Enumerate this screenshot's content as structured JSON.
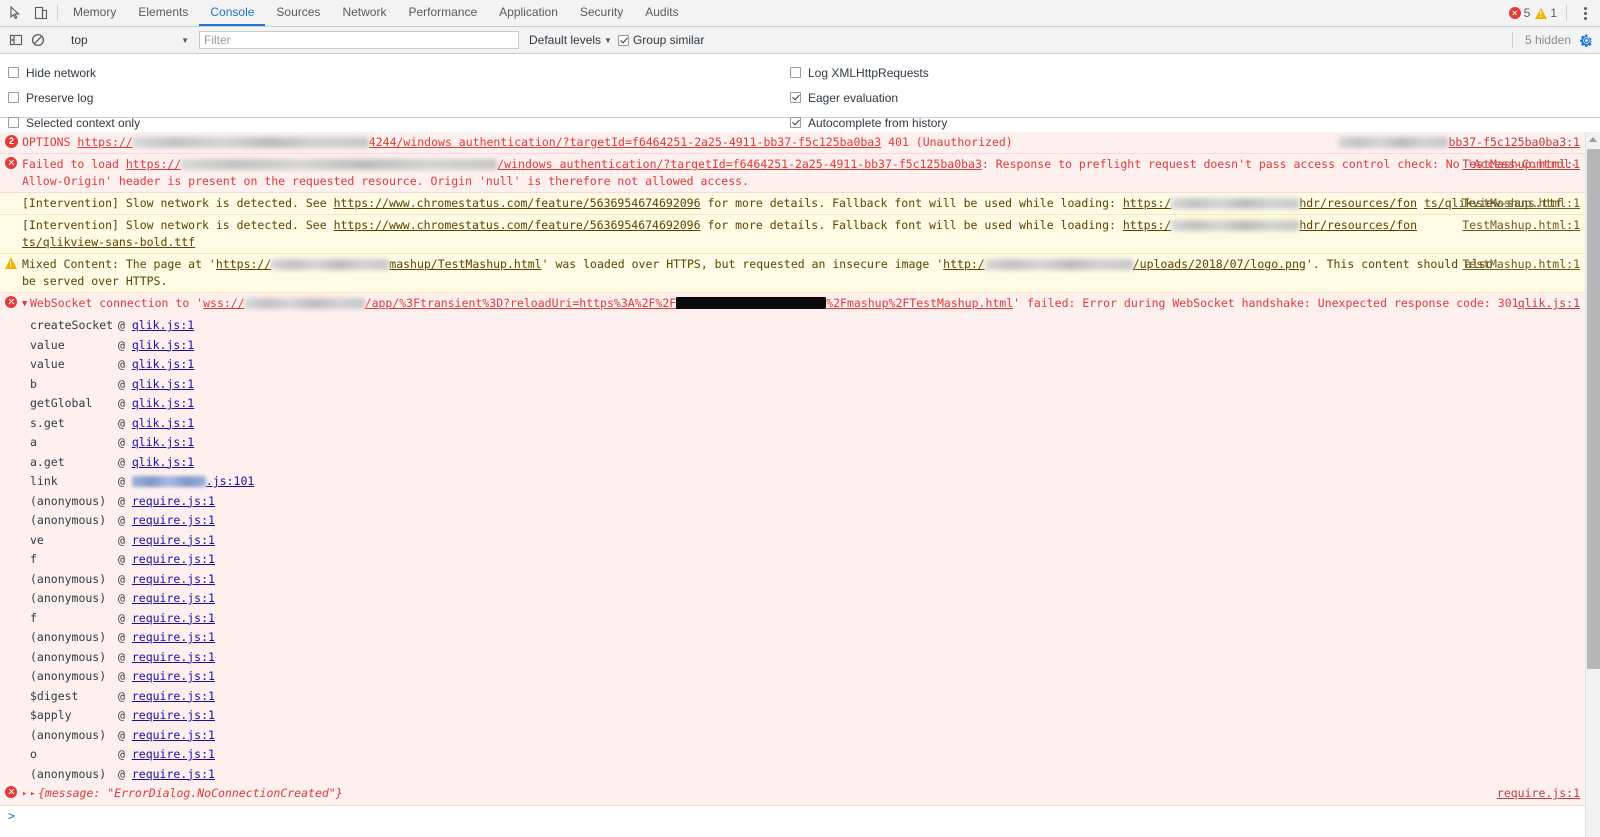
{
  "devtools": {
    "left_icons": [
      {
        "name": "inspect-element-icon",
        "glyph": "inspect"
      },
      {
        "name": "device-toolbar-icon",
        "glyph": "device"
      }
    ],
    "tabs": [
      {
        "label": "Memory",
        "active": false
      },
      {
        "label": "Elements",
        "active": false
      },
      {
        "label": "Console",
        "active": true
      },
      {
        "label": "Sources",
        "active": false
      },
      {
        "label": "Network",
        "active": false
      },
      {
        "label": "Performance",
        "active": false
      },
      {
        "label": "Application",
        "active": false
      },
      {
        "label": "Security",
        "active": false
      },
      {
        "label": "Audits",
        "active": false
      }
    ],
    "error_count": "5",
    "warning_count": "1",
    "more_menu": "kebab-menu-icon",
    "accent_color": "#1976d2",
    "error_color": "#e53935",
    "warning_color": "#f4b400"
  },
  "toolbar": {
    "sidebar_toggle": "console-sidebar-icon",
    "clear_console": "clear-console-icon",
    "context_value": "top",
    "filter_placeholder": "Filter",
    "filter_value": "",
    "levels_label": "Default levels",
    "group_similar_label": "Group similar",
    "group_similar_checked": true,
    "hidden_label": "5 hidden",
    "settings_icon": "gear-icon"
  },
  "settings": {
    "left": [
      {
        "label": "Hide network",
        "checked": false
      },
      {
        "label": "Preserve log",
        "checked": false
      },
      {
        "label": "Selected context only",
        "checked": false
      }
    ],
    "right": [
      {
        "label": "Log XMLHttpRequests",
        "checked": false
      },
      {
        "label": "Eager evaluation",
        "checked": true
      },
      {
        "label": "Autocomplete from history",
        "checked": true
      }
    ]
  },
  "console": {
    "messages": [
      {
        "level": "error",
        "badge": "2",
        "method": "OPTIONS",
        "url_prefix": "https://",
        "url_mid": "4244/windows authentication/?targetId=f6464251-2a25-4911-bb37-f5c125ba0ba3",
        "status": "401 (Unauthorized)",
        "source": "bb37-f5c125ba0ba3:1"
      },
      {
        "level": "error",
        "line1_a": "Failed to load ",
        "line1_url_prefix": "https://",
        "line1_url_suffix": "/windows authentication/?targetId=f6464251-2a25-4911-bb37-f5c125ba0ba3",
        "line1_b": ": Response to preflight request doesn't pass access control check: No 'Access-Control-",
        "line2": "Allow-Origin' header is present on the requested resource. Origin 'null' is therefore not allowed access.",
        "source": "TestMashup.html:1"
      },
      {
        "level": "warn",
        "line1_a": "[Intervention] Slow network is detected. See ",
        "link": "https://www.chromestatus.com/feature/5636954674692096",
        "line1_b": " for more details. Fallback font will be used while loading: ",
        "url_prefix": "https:/",
        "url_suffix": "hdr/resources/fon",
        "line2": "ts/qlikview-sans.ttf",
        "source": "TestMashup.html:1"
      },
      {
        "level": "warn",
        "line1_a": "[Intervention] Slow network is detected. See ",
        "link": "https://www.chromestatus.com/feature/5636954674692096",
        "line1_b": " for more details. Fallback font will be used while loading: ",
        "url_prefix": "https:/",
        "url_suffix": "hdr/resources/fon",
        "line2": "ts/qlikview-sans-bold.ttf",
        "source": "TestMashup.html:1"
      },
      {
        "level": "warn",
        "line1_a": "Mixed Content: The page at '",
        "url1_prefix": "https://",
        "url1_suffix": "mashup/TestMashup.html",
        "line1_b": "' was loaded over HTTPS, but requested an insecure image '",
        "url2_prefix": "http:/",
        "url2_suffix": "/uploads/2018/07/logo.png",
        "line1_c": "'. This content should also",
        "line2": "be served over HTTPS.",
        "source": "TestMashup.html:1"
      },
      {
        "level": "error",
        "disclosure": "▼",
        "text_a": "WebSocket connection to '",
        "url_prefix": "wss://",
        "url_mid": "/app/%3Ftransient%3D?reloadUri=https%3A%2F%2F",
        "url_suffix": "%2Fmashup%2FTestMashup.html",
        "text_b": "' failed: Error during WebSocket handshake: Unexpected response code: 301",
        "source": "qlik.js:1"
      }
    ],
    "stack_frames": [
      {
        "fn": "createSocket",
        "file": "qlik.js:1",
        "blurred": false
      },
      {
        "fn": "value",
        "file": "qlik.js:1",
        "blurred": false
      },
      {
        "fn": "value",
        "file": "qlik.js:1",
        "blurred": false
      },
      {
        "fn": "b",
        "file": "qlik.js:1",
        "blurred": false
      },
      {
        "fn": "getGlobal",
        "file": "qlik.js:1",
        "blurred": false
      },
      {
        "fn": "s.get",
        "file": "qlik.js:1",
        "blurred": false
      },
      {
        "fn": "a",
        "file": "qlik.js:1",
        "blurred": false
      },
      {
        "fn": "a.get",
        "file": "qlik.js:1",
        "blurred": false
      },
      {
        "fn": "link",
        "file": ".js:101",
        "blurred": true
      },
      {
        "fn": "(anonymous)",
        "file": "require.js:1",
        "blurred": false
      },
      {
        "fn": "(anonymous)",
        "file": "require.js:1",
        "blurred": false
      },
      {
        "fn": "ve",
        "file": "require.js:1",
        "blurred": false
      },
      {
        "fn": "f",
        "file": "require.js:1",
        "blurred": false
      },
      {
        "fn": "(anonymous)",
        "file": "require.js:1",
        "blurred": false
      },
      {
        "fn": "(anonymous)",
        "file": "require.js:1",
        "blurred": false
      },
      {
        "fn": "f",
        "file": "require.js:1",
        "blurred": false
      },
      {
        "fn": "(anonymous)",
        "file": "require.js:1",
        "blurred": false
      },
      {
        "fn": "(anonymous)",
        "file": "require.js:1",
        "blurred": false
      },
      {
        "fn": "(anonymous)",
        "file": "require.js:1",
        "blurred": false
      },
      {
        "fn": "$digest",
        "file": "require.js:1",
        "blurred": false
      },
      {
        "fn": "$apply",
        "file": "require.js:1",
        "blurred": false
      },
      {
        "fn": "(anonymous)",
        "file": "require.js:1",
        "blurred": false
      },
      {
        "fn": "o",
        "file": "require.js:1",
        "blurred": false
      },
      {
        "fn": "(anonymous)",
        "file": "require.js:1",
        "blurred": false
      }
    ],
    "final_message": {
      "level": "error",
      "text": "{message: \"ErrorDialog.NoConnectionCreated\"}",
      "source": "require.js:1"
    },
    "prompt_symbol": ">"
  }
}
